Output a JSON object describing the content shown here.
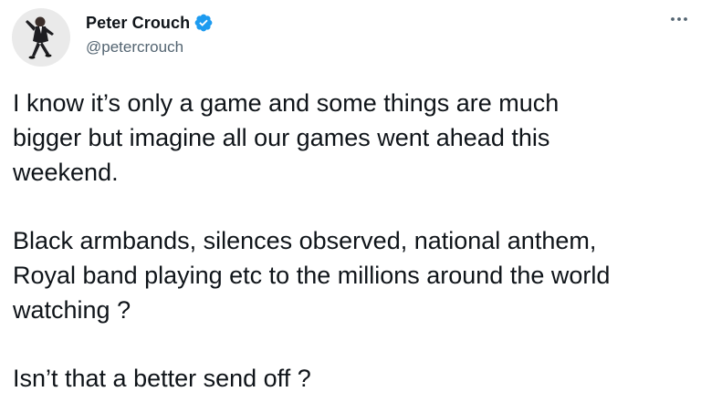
{
  "author": {
    "display_name": "Peter Crouch",
    "handle": "@petercrouch",
    "verified": true,
    "verified_color": "#1d9bf0"
  },
  "tweet": {
    "paragraph_1": [
      "I know it’s only a game and some things are much",
      "bigger but imagine all our games went ahead this",
      "weekend."
    ],
    "paragraph_2": [
      "Black armbands, silences observed, national anthem,",
      "Royal band playing etc to the millions around the world",
      "watching ?"
    ],
    "paragraph_3": [
      "Isn’t that a better send off ?"
    ]
  },
  "icons": {
    "more": "more-icon",
    "verified": "verified-badge-icon",
    "avatar": "avatar"
  }
}
